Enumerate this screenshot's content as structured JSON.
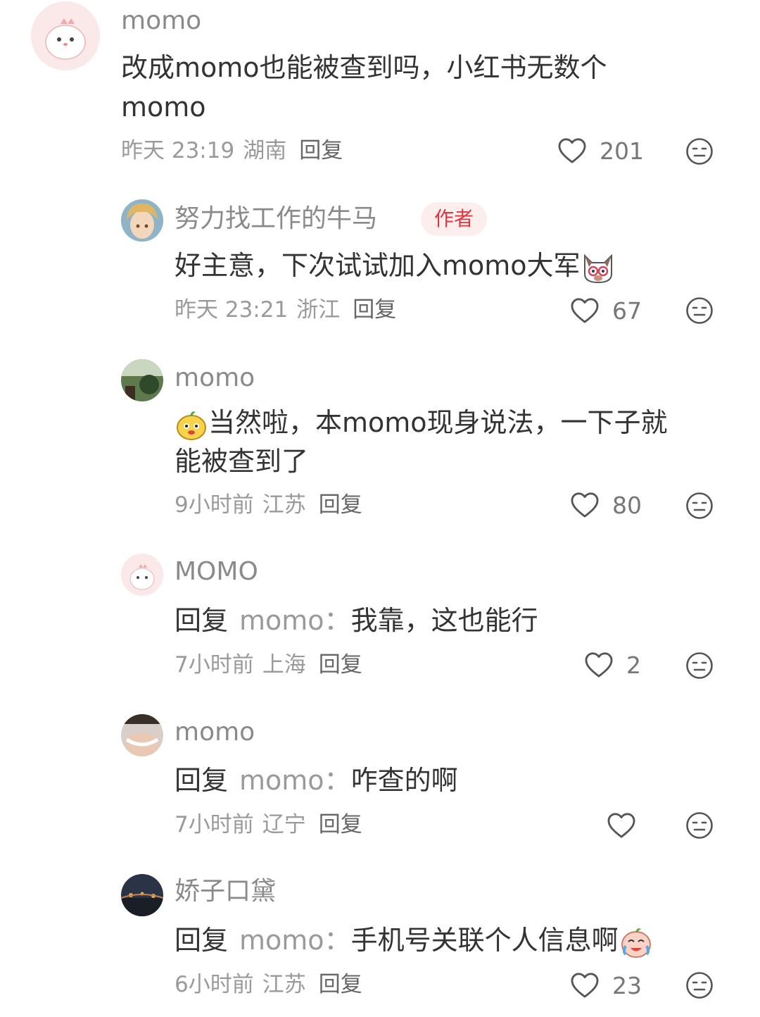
{
  "comments": [
    {
      "user": "momo",
      "text": "改成momo也能被查到吗，小红书无数个",
      "text_line2": "momo",
      "time": "昨天 23:19",
      "location": "湖南",
      "reply_label": "回复",
      "likes": "201"
    },
    {
      "user": "努力找工作的牛马",
      "badge": "作者",
      "text": "好主意，下次试试加入momo大军",
      "time": "昨天 23:21",
      "location": "浙江",
      "reply_label": "回复",
      "likes": "67"
    },
    {
      "user": "momo",
      "text": "当然啦，本momo现身说法，一下子就",
      "text_line2": "能被查到了",
      "time": "9小时前",
      "location": "江苏",
      "reply_label": "回复",
      "likes": "80"
    },
    {
      "user": "MOMO",
      "reply_prefix": "回复",
      "reply_to": "momo：",
      "text": "我靠，这也能行",
      "time": "7小时前",
      "location": "上海",
      "reply_label": "回复",
      "likes": "2"
    },
    {
      "user": "momo",
      "reply_prefix": "回复",
      "reply_to": "momo：",
      "text": "咋查的啊",
      "time": "7小时前",
      "location": "辽宁",
      "reply_label": "回复",
      "likes": ""
    },
    {
      "user": "娇子口黛",
      "reply_prefix": "回复",
      "reply_to": "momo：",
      "text": "手机号关联个人信息啊",
      "time": "6小时前",
      "location": "江苏",
      "reply_label": "回复",
      "likes": "23"
    }
  ],
  "icons": {
    "like": "heart-outline-icon",
    "more": "neutral-face-icon"
  },
  "colors": {
    "badge_text": "#e0363f",
    "badge_bg": "#fdeeee",
    "muted": "#9a9a9a"
  }
}
